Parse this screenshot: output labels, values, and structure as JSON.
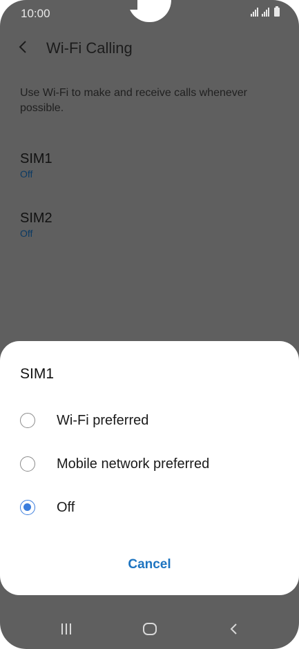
{
  "status_bar": {
    "time": "10:00"
  },
  "header": {
    "title": "Wi-Fi Calling"
  },
  "description": "Use Wi-Fi to make and receive calls whenever possible.",
  "sims": [
    {
      "name": "SIM1",
      "status": "Off"
    },
    {
      "name": "SIM2",
      "status": "Off"
    }
  ],
  "dialog": {
    "title": "SIM1",
    "options": [
      {
        "label": "Wi-Fi preferred",
        "selected": false
      },
      {
        "label": "Mobile network preferred",
        "selected": false
      },
      {
        "label": "Off",
        "selected": true
      }
    ],
    "cancel_label": "Cancel"
  },
  "colors": {
    "accent": "#3b7ddd",
    "button_text": "#1d74c0",
    "dim_overlay": "#5f5f5f"
  }
}
